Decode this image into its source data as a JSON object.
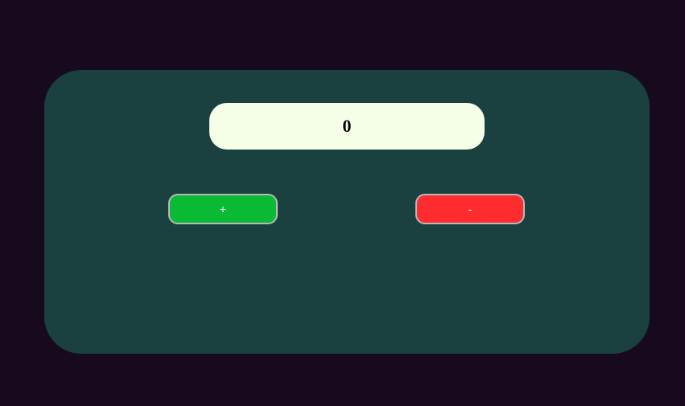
{
  "counter": {
    "value": "0",
    "increment_label": "+",
    "decrement_label": "-"
  },
  "colors": {
    "page_background": "#170a1f",
    "card_background": "#1a4040",
    "display_background": "#f5fee6",
    "increment_button": "#0ab934",
    "decrement_button": "#fe2b2f"
  }
}
